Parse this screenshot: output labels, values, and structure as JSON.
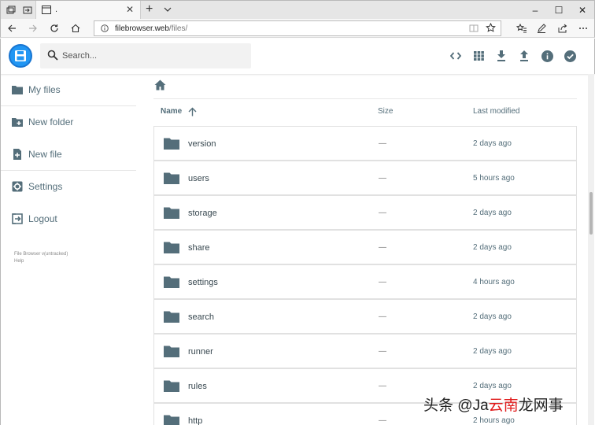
{
  "browser": {
    "tab_title": ".",
    "tab_close": "✕",
    "new_tab": "+",
    "url_host": "filebrowser.web",
    "url_path": "/files/",
    "window_controls": [
      "–",
      "☐",
      "✕"
    ]
  },
  "header": {
    "search_placeholder": "Search...",
    "actions": [
      "code-icon",
      "grid-view-icon",
      "download-icon",
      "upload-icon",
      "info-icon",
      "check-circle-icon"
    ]
  },
  "sidebar": {
    "items": [
      {
        "label": "My files",
        "icon": "folder-icon"
      },
      {
        "label": "New folder",
        "icon": "new-folder-icon"
      },
      {
        "label": "New file",
        "icon": "new-file-icon"
      },
      {
        "label": "Settings",
        "icon": "settings-icon"
      },
      {
        "label": "Logout",
        "icon": "logout-icon"
      }
    ],
    "credits_line1": "File Browser v(untracked)",
    "credits_line2": "Help"
  },
  "listing": {
    "columns": {
      "name": "Name",
      "size": "Size",
      "modified": "Last modified"
    },
    "rows": [
      {
        "name": "version",
        "size": "—",
        "modified": "2 days ago"
      },
      {
        "name": "users",
        "size": "—",
        "modified": "5 hours ago"
      },
      {
        "name": "storage",
        "size": "—",
        "modified": "2 days ago"
      },
      {
        "name": "share",
        "size": "—",
        "modified": "2 days ago"
      },
      {
        "name": "settings",
        "size": "—",
        "modified": "4 hours ago"
      },
      {
        "name": "search",
        "size": "—",
        "modified": "2 days ago"
      },
      {
        "name": "runner",
        "size": "—",
        "modified": "2 days ago"
      },
      {
        "name": "rules",
        "size": "—",
        "modified": "2 days ago"
      },
      {
        "name": "http",
        "size": "—",
        "modified": "2 hours ago"
      }
    ]
  },
  "watermark": {
    "prefix": "头条 @Ja",
    "red": "云南",
    "suffix": "龙网事"
  },
  "colors": {
    "accent": "#2196f3",
    "icon_gray": "#546e7a",
    "border": "#e1e1e1"
  }
}
